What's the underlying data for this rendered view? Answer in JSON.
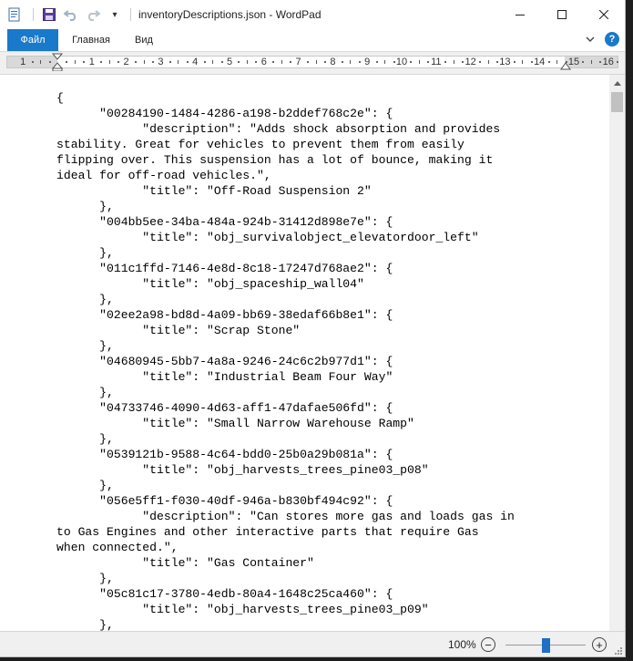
{
  "window": {
    "title": "inventoryDescriptions.json - WordPad",
    "qat_dropdown": "▾"
  },
  "ribbon": {
    "tabs": [
      {
        "label": "Файл",
        "active": true
      },
      {
        "label": "Главная",
        "active": false
      },
      {
        "label": "Вид",
        "active": false
      }
    ],
    "collapse_glyph": "⌄",
    "help_glyph": "?"
  },
  "ruler": {
    "unit_labels": [
      "1",
      "1",
      "2",
      "3",
      "4",
      "5",
      "6",
      "7",
      "8",
      "9",
      "10",
      "11",
      "12",
      "13",
      "14",
      "15",
      "16"
    ],
    "label_positions_cm": [
      -1,
      1,
      2,
      3,
      4,
      5,
      6,
      7,
      8,
      9,
      10,
      11,
      12,
      13,
      14,
      15,
      16
    ]
  },
  "document": {
    "lines": [
      "{",
      "      \"00284190-1484-4286-a198-b2ddef768c2e\": {",
      "            \"description\": \"Adds shock absorption and provides",
      "stability. Great for vehicles to prevent them from easily",
      "flipping over. This suspension has a lot of bounce, making it",
      "ideal for off-road vehicles.\",",
      "            \"title\": \"Off-Road Suspension 2\"",
      "      },",
      "      \"004bb5ee-34ba-484a-924b-31412d898e7e\": {",
      "            \"title\": \"obj_survivalobject_elevatordoor_left\"",
      "      },",
      "      \"011c1ffd-7146-4e8d-8c18-17247d768ae2\": {",
      "            \"title\": \"obj_spaceship_wall04\"",
      "      },",
      "      \"02ee2a98-bd8d-4a09-bb69-38edaf66b8e1\": {",
      "            \"title\": \"Scrap Stone\"",
      "      },",
      "      \"04680945-5bb7-4a8a-9246-24c6c2b977d1\": {",
      "            \"title\": \"Industrial Beam Four Way\"",
      "      },",
      "      \"04733746-4090-4d63-aff1-47dafae506fd\": {",
      "            \"title\": \"Small Narrow Warehouse Ramp\"",
      "      },",
      "      \"0539121b-9588-4c64-bdd0-25b0a29b081a\": {",
      "            \"title\": \"obj_harvests_trees_pine03_p08\"",
      "      },",
      "      \"056e5ff1-f030-40df-946a-b830bf494c92\": {",
      "            \"description\": \"Can stores more gas and loads gas in",
      "to Gas Engines and other interactive parts that require Gas",
      "when connected.\",",
      "            \"title\": \"Gas Container\"",
      "      },",
      "      \"05c81c17-3780-4edb-80a4-1648c25ca460\": {",
      "            \"title\": \"obj_harvests_trees_pine03_p09\"",
      "      },"
    ]
  },
  "status": {
    "zoom_label": "100%",
    "zoom_minus": "−",
    "zoom_plus": "+",
    "zoom_fraction": 0.5
  },
  "colors": {
    "file_tab_bg": "#1979ca",
    "zoom_thumb": "#1f6fc4"
  }
}
